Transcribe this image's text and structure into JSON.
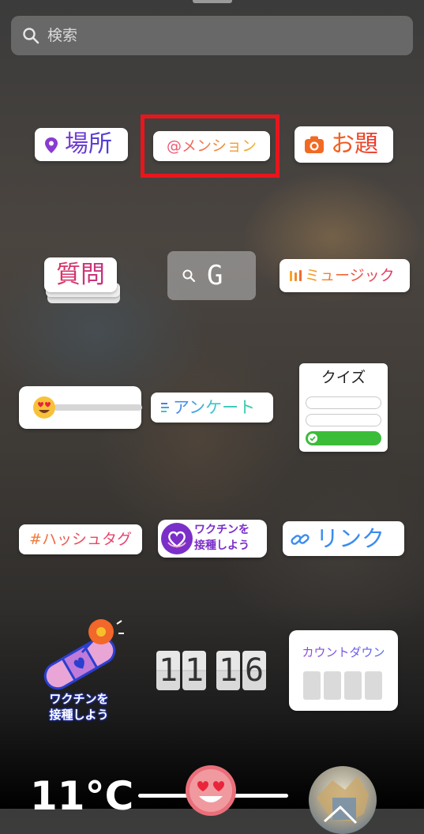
{
  "search": {
    "placeholder": "検索"
  },
  "stickers": {
    "location": "場所",
    "mention": "@メンション",
    "theme": "お題",
    "question": "質問",
    "gif_search": "G",
    "music": "ミュージック",
    "poll": "アンケート",
    "quiz": "クイズ",
    "hashtag": "#ハッシュタグ",
    "vaccine_line1": "ワクチンを",
    "vaccine_line2": "接種しよう",
    "link": "リンク",
    "bandage_line1": "ワクチンを",
    "bandage_line2": "接種しよう",
    "clock_digits": [
      "1",
      "1",
      "1",
      "6"
    ],
    "countdown": "カウントダウン",
    "temperature": "11°C"
  },
  "icons": {
    "search": "search-icon",
    "location": "location-pin-icon",
    "theme": "camera-icon",
    "music": "music-bars-icon",
    "link": "link-icon"
  },
  "colors": {
    "highlight": "#e8161c",
    "quiz_correct": "#3bbd3a"
  }
}
